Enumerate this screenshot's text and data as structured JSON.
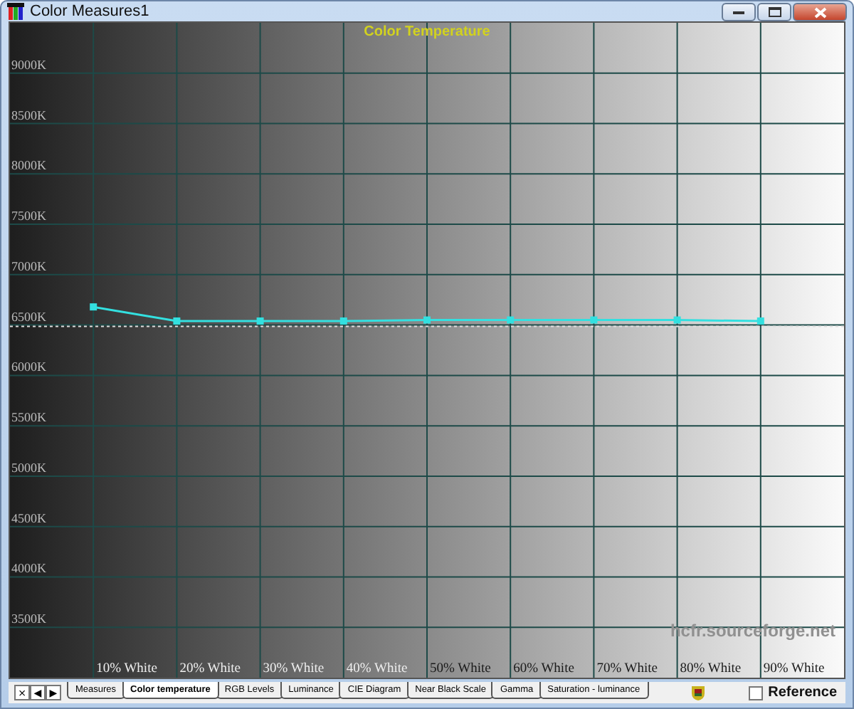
{
  "window": {
    "title": "Color Measures1"
  },
  "chart": {
    "watermark": "hcfr.sourceforge.net",
    "chart_data": {
      "type": "line",
      "title": "Color Temperature",
      "categories": [
        "10% White",
        "20% White",
        "30% White",
        "40% White",
        "50% White",
        "60% White",
        "70% White",
        "80% White",
        "90% White"
      ],
      "series": [
        {
          "color": "#33e0e0",
          "marker": "square",
          "values": [
            6680,
            6540,
            6540,
            6540,
            6550,
            6550,
            6550,
            6550,
            6540
          ]
        }
      ],
      "grid": true,
      "ylim": [
        3000,
        9500
      ],
      "yticks": [
        {
          "value": 3500,
          "label": "3500K"
        },
        {
          "value": 4000,
          "label": "4000K"
        },
        {
          "value": 4500,
          "label": "4500K"
        },
        {
          "value": 5000,
          "label": "5000K"
        },
        {
          "value": 5500,
          "label": "5500K"
        },
        {
          "value": 6000,
          "label": "6000K"
        },
        {
          "value": 6500,
          "label": "6500K"
        },
        {
          "value": 7000,
          "label": "7000K"
        },
        {
          "value": 7500,
          "label": "7500K"
        },
        {
          "value": 8000,
          "label": "8000K"
        },
        {
          "value": 8500,
          "label": "8500K"
        },
        {
          "value": 9000,
          "label": "9000K"
        }
      ],
      "ref_lines": [
        {
          "axis": "y",
          "value": 6500
        }
      ]
    }
  },
  "nav_buttons": [
    "×",
    "◀",
    "▶"
  ],
  "tabs": [
    {
      "label": "Measures",
      "selected": false
    },
    {
      "label": "Color temperature",
      "selected": true
    },
    {
      "label": "RGB Levels",
      "selected": false
    },
    {
      "label": "Luminance",
      "selected": false
    },
    {
      "label": "CIE Diagram",
      "selected": false
    },
    {
      "label": "Near Black Scale",
      "selected": false
    },
    {
      "label": "Gamma",
      "selected": false
    },
    {
      "label": "Saturation - luminance",
      "selected": false
    }
  ],
  "reference": {
    "label": "Reference",
    "checked": false
  }
}
